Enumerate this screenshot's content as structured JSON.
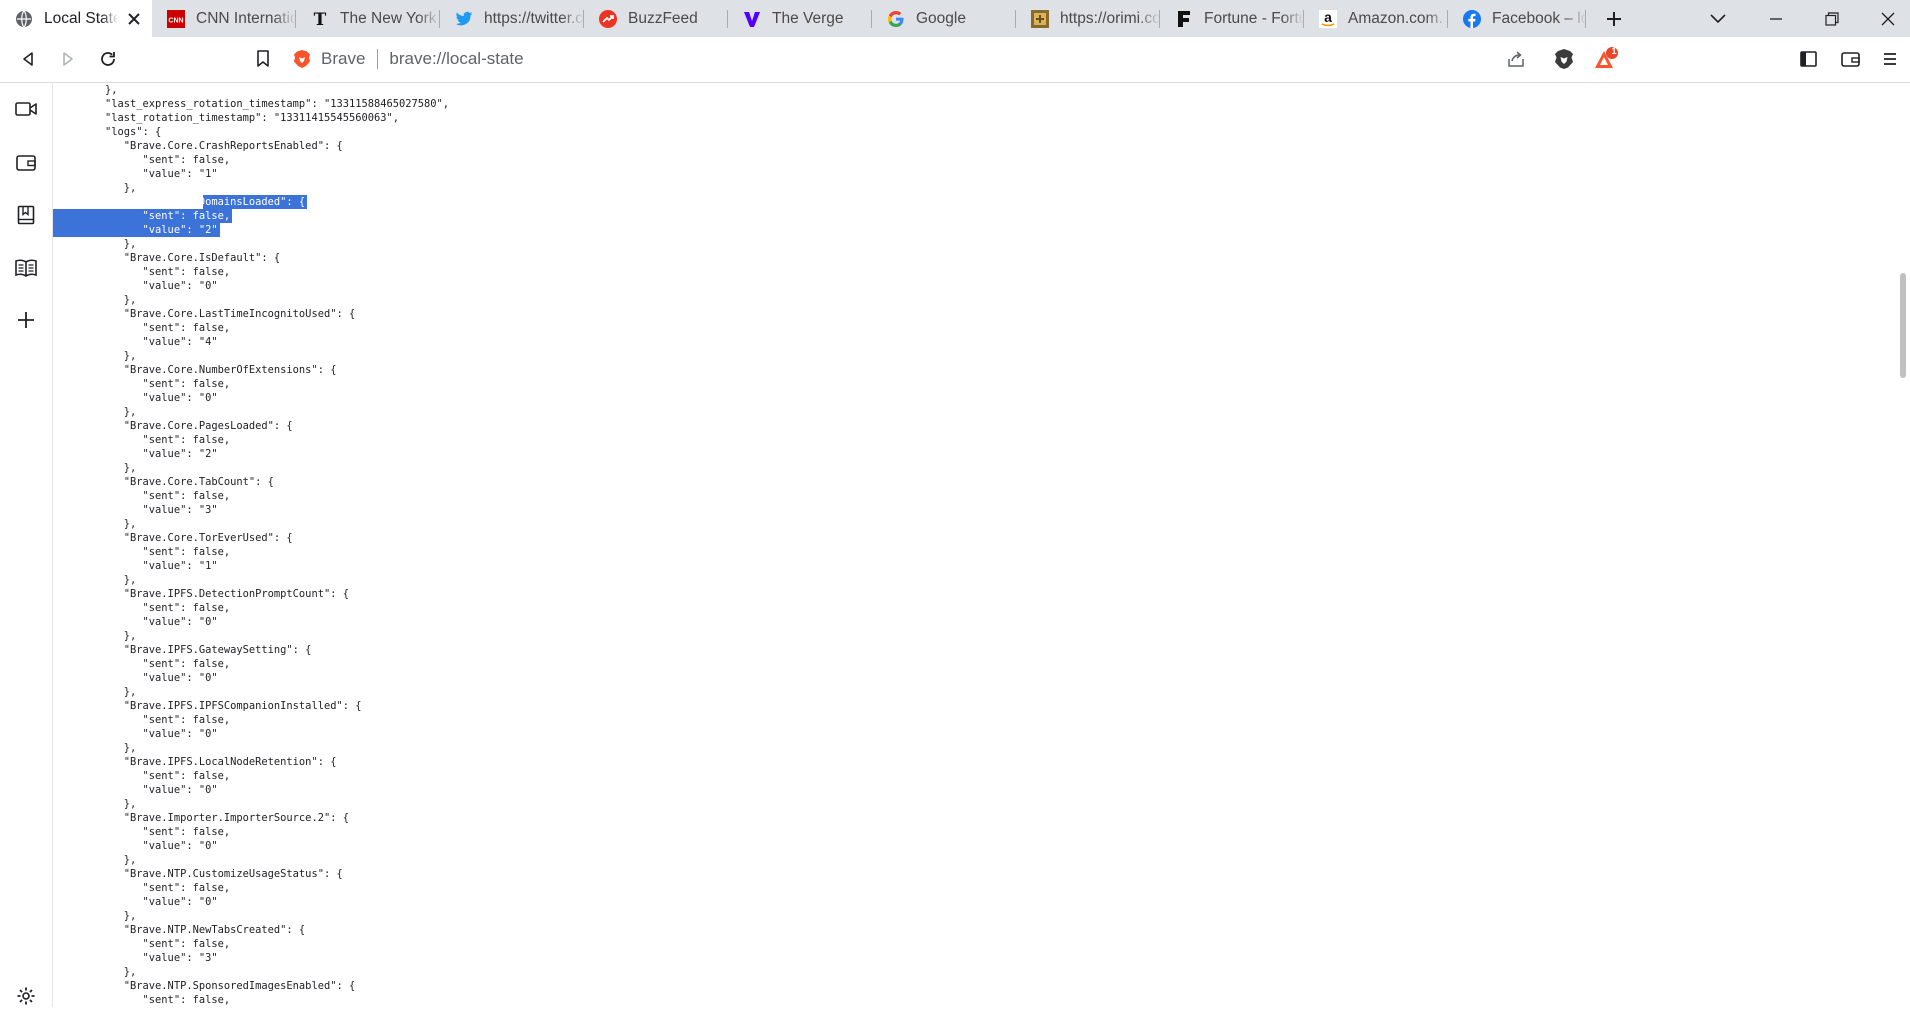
{
  "tabs": [
    {
      "title": "Local State",
      "icon": "globe-icon",
      "active": true
    },
    {
      "title": "CNN International",
      "icon": "cnn-logo-icon"
    },
    {
      "title": "The New York Times",
      "icon": "nyt-logo-icon"
    },
    {
      "title": "https://twitter.com",
      "icon": "twitter-bird-icon"
    },
    {
      "title": "BuzzFeed",
      "icon": "buzzfeed-logo-icon"
    },
    {
      "title": "The Verge",
      "icon": "verge-logo-icon"
    },
    {
      "title": "Google",
      "icon": "google-g-icon"
    },
    {
      "title": "https://orimi.com",
      "icon": "orimi-logo-icon"
    },
    {
      "title": "Fortune - Fortune",
      "icon": "fortune-f-icon"
    },
    {
      "title": "Amazon.com. Spend",
      "icon": "amazon-a-icon"
    },
    {
      "title": "Facebook – log in",
      "icon": "facebook-icon"
    }
  ],
  "omnibox": {
    "brand": "Brave",
    "url": "brave://local-state"
  },
  "rewards_badge": "1",
  "colors": {
    "selection": "#3b73d8",
    "brave_orange": "#fb542b",
    "tab_strip": "#dee1e6"
  },
  "json_lines": [
    "},",
    "\"last_express_rotation_timestamp\": \"13311588465027580\",",
    "\"last_rotation_timestamp\": \"13311415545560063\",",
    "\"logs\": {",
    "   \"Brave.Core.CrashReportsEnabled\": {",
    "      \"sent\": false,",
    "      \"value\": \"1\"",
    "   },",
    "   \"Brave.Core.DomainsLoaded\": {",
    "      \"sent\": false,",
    "      \"value\": \"2\"",
    "   },",
    "   \"Brave.Core.IsDefault\": {",
    "      \"sent\": false,",
    "      \"value\": \"0\"",
    "   },",
    "   \"Brave.Core.LastTimeIncognitoUsed\": {",
    "      \"sent\": false,",
    "      \"value\": \"4\"",
    "   },",
    "   \"Brave.Core.NumberOfExtensions\": {",
    "      \"sent\": false,",
    "      \"value\": \"0\"",
    "   },",
    "   \"Brave.Core.PagesLoaded\": {",
    "      \"sent\": false,",
    "      \"value\": \"2\"",
    "   },",
    "   \"Brave.Core.TabCount\": {",
    "      \"sent\": false,",
    "      \"value\": \"3\"",
    "   },",
    "   \"Brave.Core.TorEverUsed\": {",
    "      \"sent\": false,",
    "      \"value\": \"1\"",
    "   },",
    "   \"Brave.IPFS.DetectionPromptCount\": {",
    "      \"sent\": false,",
    "      \"value\": \"0\"",
    "   },",
    "   \"Brave.IPFS.GatewaySetting\": {",
    "      \"sent\": false,",
    "      \"value\": \"0\"",
    "   },",
    "   \"Brave.IPFS.IPFSCompanionInstalled\": {",
    "      \"sent\": false,",
    "      \"value\": \"0\"",
    "   },",
    "   \"Brave.IPFS.LocalNodeRetention\": {",
    "      \"sent\": false,",
    "      \"value\": \"0\"",
    "   },",
    "   \"Brave.Importer.ImporterSource.2\": {",
    "      \"sent\": false,",
    "      \"value\": \"0\"",
    "   },",
    "   \"Brave.NTP.CustomizeUsageStatus\": {",
    "      \"sent\": false,",
    "      \"value\": \"0\"",
    "   },",
    "   \"Brave.NTP.NewTabsCreated\": {",
    "      \"sent\": false,",
    "      \"value\": \"3\"",
    "   },",
    "   \"Brave.NTP.SponsoredImagesEnabled\": {",
    "      \"sent\": false,"
  ],
  "selected_lines": [
    8,
    9,
    10
  ]
}
